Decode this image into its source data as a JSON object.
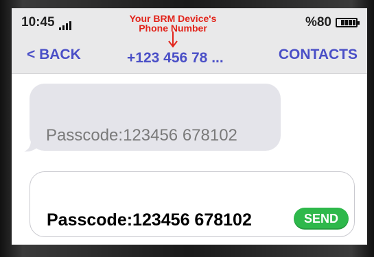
{
  "status_bar": {
    "time": "10:45",
    "battery": "%80",
    "battery_level": 0.8
  },
  "annotation": {
    "line1": "Your BRM Device's",
    "line2": "Phone Number"
  },
  "nav": {
    "back_label": "< BACK",
    "title": "+123 456 78 ...",
    "contacts_label": "CONTACTS"
  },
  "messages": [
    {
      "text": "Passcode:123456 678102"
    }
  ],
  "composer": {
    "text": "Passcode:123456 678102",
    "send_label": "SEND"
  },
  "colors": {
    "accent": "#4a4fc7",
    "annotation": "#e2231a",
    "send": "#2eb84b",
    "incoming_bubble": "#e4e4ea"
  }
}
